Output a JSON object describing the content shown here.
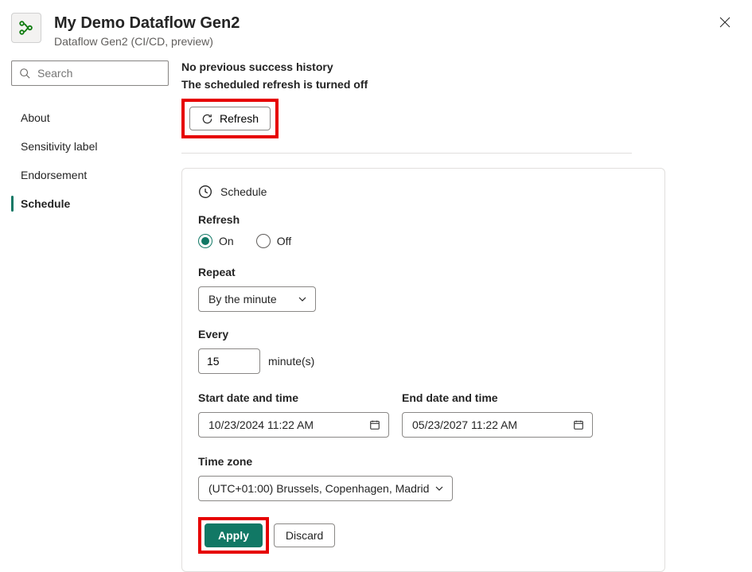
{
  "header": {
    "title": "My Demo Dataflow Gen2",
    "subtitle": "Dataflow Gen2 (CI/CD, preview)"
  },
  "search": {
    "placeholder": "Search"
  },
  "nav": {
    "items": [
      {
        "label": "About"
      },
      {
        "label": "Sensitivity label"
      },
      {
        "label": "Endorsement"
      },
      {
        "label": "Schedule"
      }
    ]
  },
  "main": {
    "no_history": "No previous success history",
    "refresh_off": "The scheduled refresh is turned off",
    "refresh_label": "Refresh"
  },
  "panel": {
    "head": "Schedule",
    "refresh_label": "Refresh",
    "radio_on": "On",
    "radio_off": "Off",
    "repeat_label": "Repeat",
    "repeat_value": "By the minute",
    "every_label": "Every",
    "every_value": "15",
    "every_unit": "minute(s)",
    "start_label": "Start date and time",
    "start_value": "10/23/2024  11:22 AM",
    "end_label": "End date and time",
    "end_value": "05/23/2027  11:22 AM",
    "tz_label": "Time zone",
    "tz_value": "(UTC+01:00) Brussels, Copenhagen, Madrid",
    "apply_label": "Apply",
    "discard_label": "Discard"
  }
}
